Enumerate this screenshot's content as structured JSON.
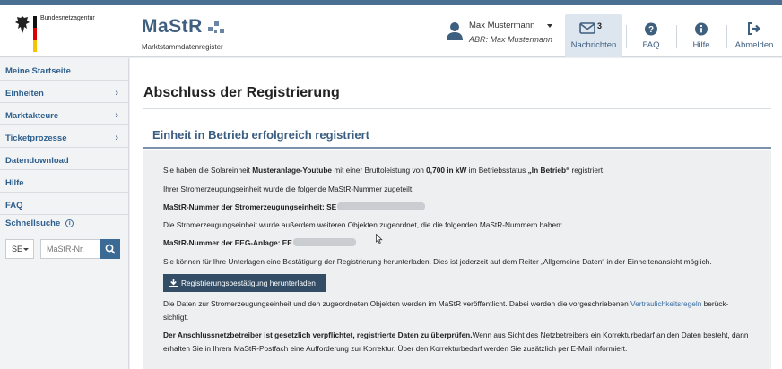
{
  "header": {
    "agency": "Bundesnetzagentur",
    "logo_title": "MaStR",
    "logo_subtitle": "Marktstammdatenregister",
    "user_name": "Max Mustermann",
    "user_sub": "ABR: Max Mustermann",
    "nav": {
      "messages_label": "Nachrichten",
      "messages_count": "3",
      "faq_label": "FAQ",
      "help_label": "Hilfe",
      "logout_label": "Abmelden"
    }
  },
  "sidebar": {
    "items": [
      {
        "label": "Meine Startseite",
        "chevron": false
      },
      {
        "label": "Einheiten",
        "chevron": true
      },
      {
        "label": "Marktakteure",
        "chevron": true
      },
      {
        "label": "Ticketprozesse",
        "chevron": true
      },
      {
        "label": "Datendownload",
        "chevron": false
      },
      {
        "label": "Hilfe",
        "chevron": false
      },
      {
        "label": "FAQ",
        "chevron": false
      }
    ],
    "quicksearch_label": "Schnellsuche",
    "quicksearch_prefix": "SE",
    "quicksearch_placeholder": "MaStR-Nr."
  },
  "main": {
    "page_title": "Abschluss der Registrierung",
    "section_title": "Einheit in Betrieb erfolgreich registriert",
    "p1_a": "Sie haben die Solareinheit ",
    "p1_unit": "Musteranlage-Youtube",
    "p1_b": " mit einer Bruttoleistung von ",
    "p1_power": "0,700 in kW",
    "p1_c": " im Betriebsstatus ",
    "p1_status": "„In Betrieb“",
    "p1_d": " registriert.",
    "p2": "Ihrer Stromerzeugungseinheit wurde die folgende MaStR-Nummer zugeteilt:",
    "p3_label": "MaStR-Nummer der Stromerzeugungseinheit: SE",
    "p4": "Die Stromerzeugungseinheit wurde außerdem weiteren Objekten zugeordnet, die die folgenden MaStR-Nummern haben:",
    "p5_label": "MaStR-Nummer der EEG-Anlage: EE",
    "p6": "Sie können für Ihre Unterlagen eine Bestätigung der Registrierung herunterladen. Dies ist jederzeit auf dem Reiter „Allgemeine Daten“ in der Einheitenansicht möglich.",
    "download_button": "Registrierungsbestätigung herunterladen",
    "p7_a": "Die Daten zur Stromerzeugungseinheit und den zugeordneten Objekten werden im MaStR veröffentlicht. Dabei werden die vorgeschriebenen ",
    "p7_link": "Vertraulichkeitsregeln",
    "p7_b": " berück-",
    "p7_c": "sichtigt.",
    "p8_bold": "Der Anschlussnetzbetreiber ist gesetzlich verpflichtet, registrierte Daten zu überprüfen.",
    "p8_a": "Wenn aus Sicht des Netzbetreibers ein Korrekturbedarf an den Daten besteht, dann",
    "p8_b": "erhalten Sie in Ihrem MaStR-Postfach eine Aufforderung zur Korrektur. Über den Korrekturbedarf werden Sie zusätzlich per E-Mail informiert."
  },
  "colors": {
    "brand": "#3f5f7f",
    "download_button": "#334d66",
    "link": "#3a6fa3"
  }
}
